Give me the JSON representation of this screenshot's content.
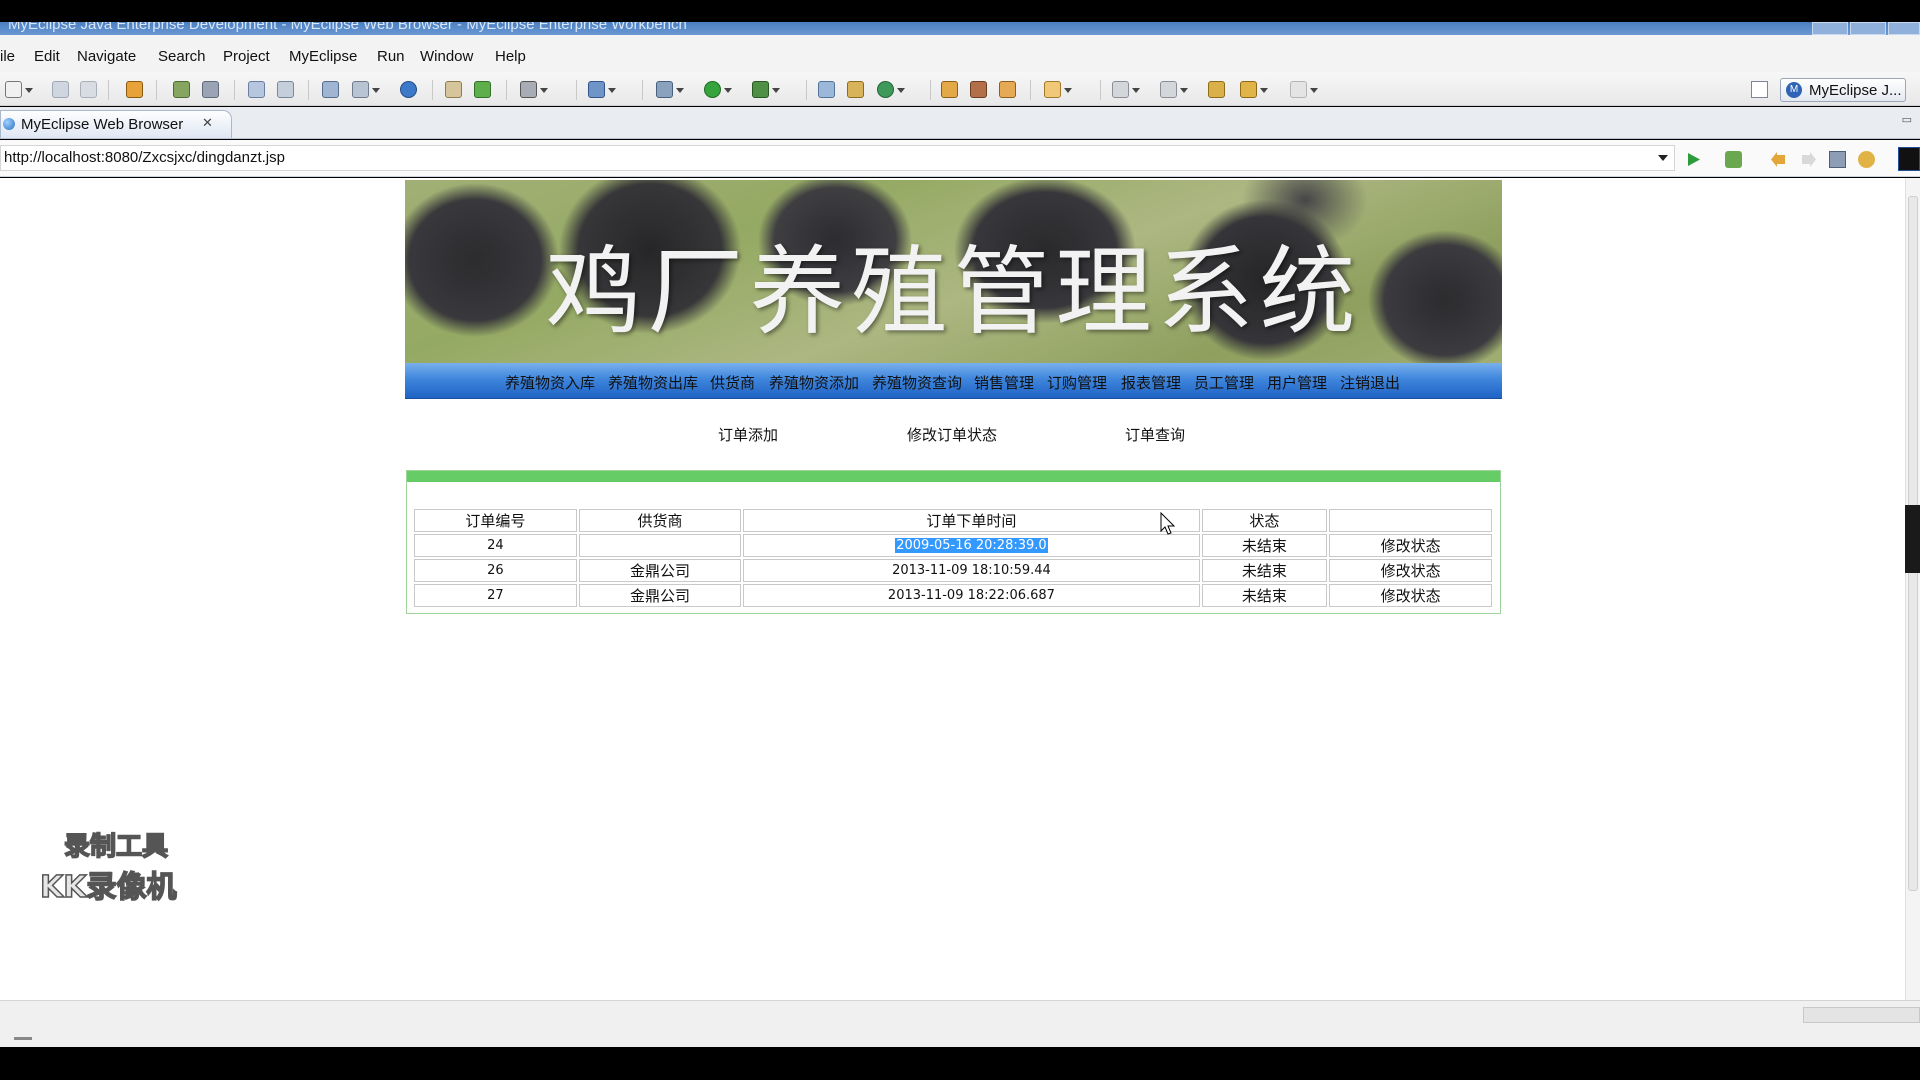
{
  "window": {
    "title": "MyEclipse Java Enterprise Development - MyEclipse Web Browser - MyEclipse Enterprise Workbench"
  },
  "menus": [
    "ile",
    "Edit",
    "Navigate",
    "Search",
    "Project",
    "MyEclipse",
    "Run",
    "Window",
    "Help"
  ],
  "toolbar": {
    "perspective_label": "MyEclipse J..."
  },
  "editor_tab": {
    "label": "MyEclipse Web Browser",
    "close": "✕"
  },
  "address": {
    "url": "http://localhost:8080/Zxcsjxc/dingdanzt.jsp"
  },
  "page": {
    "banner_title": "鸡厂养殖管理系统",
    "nav": [
      "养殖物资入库",
      "养殖物资出库",
      "供货商",
      "养殖物资添加",
      "养殖物资查询",
      "销售管理",
      "订购管理",
      "报表管理",
      "员工管理",
      "用户管理",
      "注销退出"
    ],
    "sublinks": [
      "订单添加",
      "修改订单状态",
      "订单查询"
    ],
    "table": {
      "headers": [
        "订单编号",
        "供货商",
        "订单下单时间",
        "状态",
        ""
      ],
      "rows": [
        {
          "id": "24",
          "supplier": "",
          "time": "2009-05-16 20:28:39.0",
          "status": "未结束",
          "action": "修改状态"
        },
        {
          "id": "26",
          "supplier": "金鼎公司",
          "time": "2013-11-09 18:10:59.44",
          "status": "未结束",
          "action": "修改状态"
        },
        {
          "id": "27",
          "supplier": "金鼎公司",
          "time": "2013-11-09 18:22:06.687",
          "status": "未结束",
          "action": "修改状态"
        }
      ]
    }
  },
  "watermark": {
    "line1": "录制工具",
    "line2": "KK录像机"
  },
  "colors": {
    "nav_blue": "#3f86dd",
    "panel_green": "#66cc66",
    "selection": "#3399ff"
  }
}
